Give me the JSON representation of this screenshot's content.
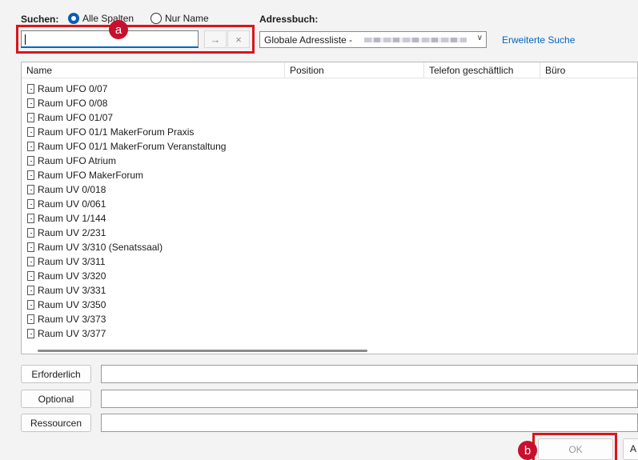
{
  "search": {
    "label": "Suchen:",
    "radio_all_columns": "Alle Spalten",
    "radio_name_only": "Nur Name",
    "value": "",
    "go_glyph": "→",
    "clear_glyph": "×"
  },
  "addressbook": {
    "label": "Adressbuch:",
    "selected": "Globale Adressliste -",
    "advanced_link": "Erweiterte Suche"
  },
  "callouts": {
    "a": "a",
    "b": "b"
  },
  "table": {
    "columns": [
      "Name",
      "Position",
      "Telefon geschäftlich",
      "Büro"
    ],
    "rows": [
      "Raum UFO 0/07",
      "Raum UFO 0/08",
      "Raum UFO 01/07",
      "Raum UFO 01/1 MakerForum Praxis",
      "Raum UFO 01/1 MakerForum Veranstaltung",
      "Raum UFO Atrium",
      "Raum UFO MakerForum",
      "Raum UV 0/018",
      "Raum UV 0/061",
      "Raum UV 1/144",
      "Raum UV 2/231",
      "Raum UV 3/310 (Senatssaal)",
      "Raum UV 3/311",
      "Raum UV 3/320",
      "Raum UV 3/331",
      "Raum UV 3/350",
      "Raum UV 3/373",
      "Raum UV 3/377"
    ]
  },
  "recipients": {
    "required": "Erforderlich",
    "optional": "Optional",
    "resources": "Ressourcen"
  },
  "footer": {
    "ok": "OK",
    "next_btn": "A"
  },
  "colors": {
    "highlight": "#d9161b",
    "callout": "#c8102e",
    "link": "#0067c0",
    "radio_selected": "#0a5bb5"
  }
}
